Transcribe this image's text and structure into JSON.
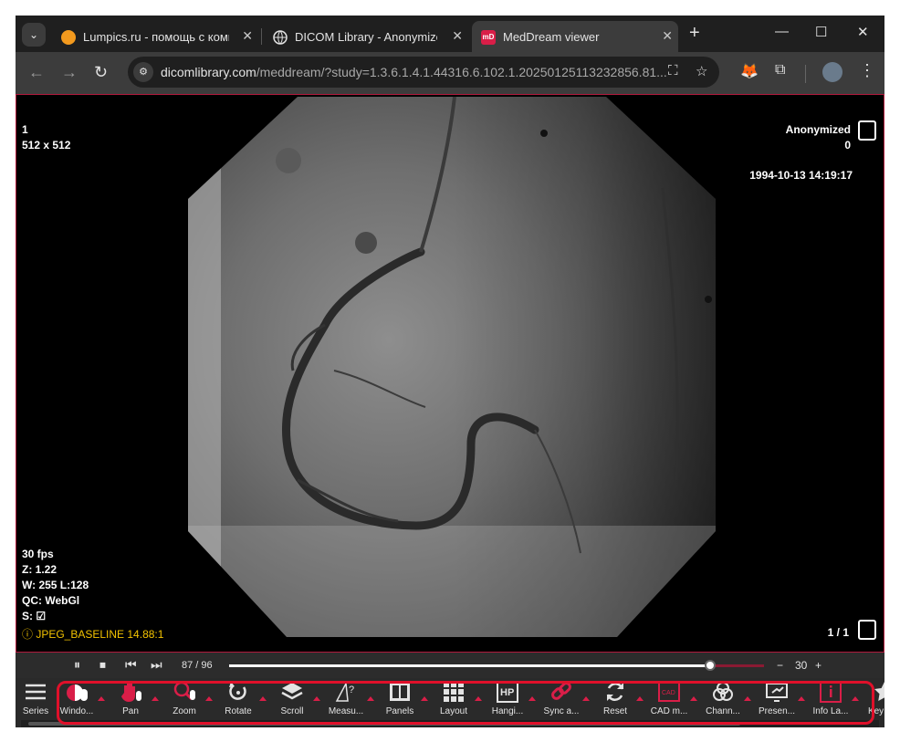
{
  "browser": {
    "tabs": [
      {
        "title": "Lumpics.ru - помощь с компь",
        "favicon": "lumpics-orange-icon",
        "active": false
      },
      {
        "title": "DICOM Library - Anonymize, S",
        "favicon": "globe-icon",
        "active": false
      },
      {
        "title": "MedDream viewer",
        "favicon": "meddream-icon",
        "active": true
      }
    ],
    "new_tab": "+",
    "window_controls": {
      "minimize": "—",
      "maximize": "☐",
      "close": "✕"
    },
    "url_host": "dicomlibrary.com",
    "url_path": "/meddream/?study=1.3.6.1.4.1.44316.6.102.1.20250125113232856.81..."
  },
  "overlay": {
    "top_left": [
      "1",
      "512 x 512"
    ],
    "top_right": [
      "Anonymized",
      "0"
    ],
    "date": "1994-10-13 14:19:17",
    "bottom_left": [
      "30 fps",
      "Z: 1.22",
      "W: 255 L:128",
      "QC: WebGl",
      "S: ☑"
    ],
    "codec": "JPEG_BASELINE 14.88:1",
    "page": "1 / 1"
  },
  "cine": {
    "frame": "87 / 96",
    "progress": 0.9,
    "fps": "30",
    "minus": "−",
    "plus": "+"
  },
  "toolbar": {
    "series_label": "Series",
    "tools": [
      {
        "label": "Windo...",
        "icon": "window-level-icon"
      },
      {
        "label": "Pan",
        "icon": "hand-icon"
      },
      {
        "label": "Zoom",
        "icon": "zoom-icon"
      },
      {
        "label": "Rotate",
        "icon": "rotate-icon"
      },
      {
        "label": "Scroll",
        "icon": "layers-icon"
      },
      {
        "label": "Measu...",
        "icon": "measure-icon"
      },
      {
        "label": "Panels",
        "icon": "panels-icon"
      },
      {
        "label": "Layout",
        "icon": "grid-icon"
      },
      {
        "label": "Hangi...",
        "icon": "hanging-protocol-icon"
      },
      {
        "label": "Sync a...",
        "icon": "link-icon"
      },
      {
        "label": "Reset",
        "icon": "reset-icon"
      },
      {
        "label": "CAD m...",
        "icon": "cad-icon"
      },
      {
        "label": "Chann...",
        "icon": "channels-icon"
      },
      {
        "label": "Presen...",
        "icon": "presentation-icon"
      },
      {
        "label": "Info La...",
        "icon": "info-layer-icon"
      },
      {
        "label": "Key O...",
        "icon": "star-icon"
      }
    ]
  },
  "colors": {
    "accent": "#d91e48",
    "highlight": "#e0102a"
  }
}
